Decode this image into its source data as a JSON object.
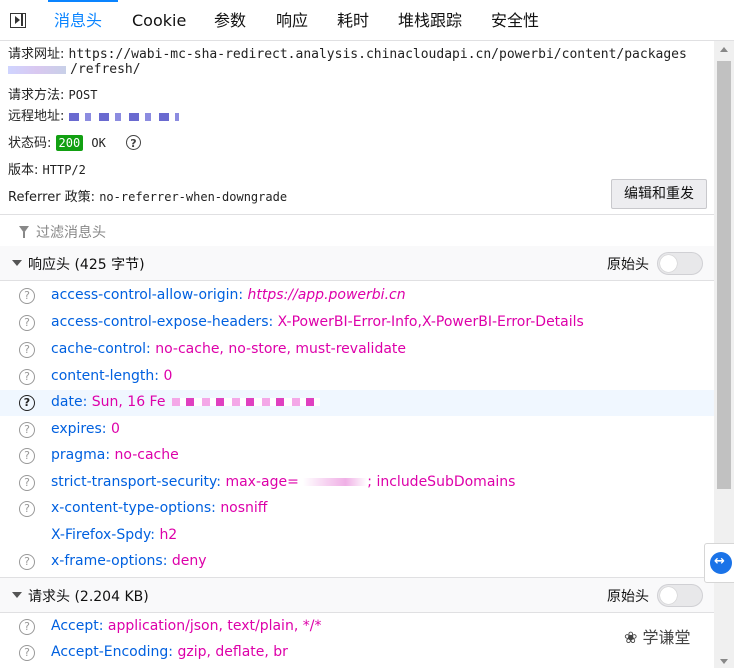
{
  "tabs": [
    {
      "label": "消息头",
      "selected": true
    },
    {
      "label": "Cookie",
      "selected": false
    },
    {
      "label": "参数",
      "selected": false
    },
    {
      "label": "响应",
      "selected": false
    },
    {
      "label": "耗时",
      "selected": false
    },
    {
      "label": "堆栈跟踪",
      "selected": false
    },
    {
      "label": "安全性",
      "selected": false
    }
  ],
  "summary": {
    "url_label": "请求网址:",
    "url_value": "https://wabi-mc-sha-redirect.analysis.chinacloudapi.cn/powerbi/content/packages",
    "url_value_cont": "/refresh/",
    "method_label": "请求方法:",
    "method_value": "POST",
    "remote_label": "远程地址:",
    "status_label": "状态码:",
    "status_code": "200",
    "status_text": "OK",
    "version_label": "版本:",
    "version_value": "HTTP/2",
    "referrer_label": "Referrer 政策:",
    "referrer_value": "no-referrer-when-downgrade",
    "edit_resend": "编辑和重发"
  },
  "filter": {
    "placeholder": "过滤消息头"
  },
  "response_headers": {
    "title": "响应头 (425 字节)",
    "raw_label": "原始头",
    "rows": [
      {
        "name": "access-control-allow-origin:",
        "value": "https://app.powerbi.cn"
      },
      {
        "name": "access-control-expose-headers:",
        "value": "X-PowerBI-Error-Info,X-PowerBI-Error-Details"
      },
      {
        "name": "cache-control:",
        "value": "no-cache, no-store, must-revalidate"
      },
      {
        "name": "content-length:",
        "value": "0"
      },
      {
        "name": "date:",
        "value": "Sun, 16 Fe"
      },
      {
        "name": "expires:",
        "value": "0"
      },
      {
        "name": "pragma:",
        "value": "no-cache"
      },
      {
        "name": "strict-transport-security:",
        "value": "max-age=",
        "value_cont": "; includeSubDomains"
      },
      {
        "name": "x-content-type-options:",
        "value": "nosniff"
      },
      {
        "name": "X-Firefox-Spdy:",
        "value": "h2"
      },
      {
        "name": "x-frame-options:",
        "value": "deny"
      }
    ]
  },
  "request_headers": {
    "title": "请求头 (2.204 KB)",
    "raw_label": "原始头",
    "rows": [
      {
        "name": "Accept:",
        "value": "application/json, text/plain, */*"
      },
      {
        "name": "Accept-Encoding:",
        "value": "gzip, deflate, br"
      }
    ]
  },
  "watermark": "学谦堂",
  "colors": {
    "accent": "#0a84ff",
    "header_name": "#0060df",
    "header_value": "#dd00a9",
    "status_ok": "#12a012"
  }
}
